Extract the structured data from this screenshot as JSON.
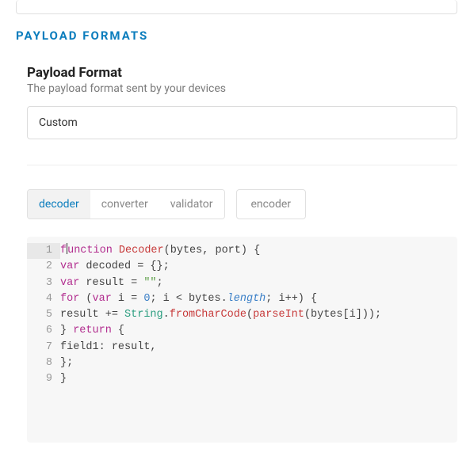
{
  "section_header": "PAYLOAD FORMATS",
  "subtitle": "Payload Format",
  "subdesc": "The payload format sent by your devices",
  "select_value": "Custom",
  "tabs": {
    "group": [
      {
        "label": "decoder",
        "active": true
      },
      {
        "label": "converter",
        "active": false
      },
      {
        "label": "validator",
        "active": false
      }
    ],
    "single": {
      "label": "encoder"
    }
  },
  "code": {
    "lines": [
      {
        "n": 1,
        "tokens": [
          {
            "t": "f",
            "c": "kw"
          },
          {
            "cursor": true
          },
          {
            "t": "unction ",
            "c": "kw"
          },
          {
            "t": "Decoder",
            "c": "fn"
          },
          {
            "t": "(",
            "c": "punc"
          },
          {
            "t": "bytes",
            "c": "id"
          },
          {
            "t": ", ",
            "c": "punc"
          },
          {
            "t": "port",
            "c": "id"
          },
          {
            "t": ") {",
            "c": "punc"
          }
        ]
      },
      {
        "n": 2,
        "tokens": [
          {
            "t": "var ",
            "c": "kw"
          },
          {
            "t": "decoded ",
            "c": "id"
          },
          {
            "t": "= ",
            "c": "punc"
          },
          {
            "t": "{};",
            "c": "punc"
          }
        ]
      },
      {
        "n": 3,
        "tokens": [
          {
            "t": "var ",
            "c": "kw"
          },
          {
            "t": "result ",
            "c": "id"
          },
          {
            "t": "= ",
            "c": "punc"
          },
          {
            "t": "\"\"",
            "c": "str"
          },
          {
            "t": ";",
            "c": "punc"
          }
        ]
      },
      {
        "n": 4,
        "tokens": [
          {
            "t": "for ",
            "c": "kw"
          },
          {
            "t": "(",
            "c": "punc"
          },
          {
            "t": "var ",
            "c": "kw"
          },
          {
            "t": "i ",
            "c": "id"
          },
          {
            "t": "= ",
            "c": "punc"
          },
          {
            "t": "0",
            "c": "num"
          },
          {
            "t": "; ",
            "c": "punc"
          },
          {
            "t": "i ",
            "c": "id"
          },
          {
            "t": "< ",
            "c": "punc"
          },
          {
            "t": "bytes",
            "c": "id"
          },
          {
            "t": ".",
            "c": "punc"
          },
          {
            "t": "length",
            "c": "prop"
          },
          {
            "t": "; ",
            "c": "punc"
          },
          {
            "t": "i",
            "c": "id"
          },
          {
            "t": "++) {",
            "c": "punc"
          }
        ]
      },
      {
        "n": 5,
        "tokens": [
          {
            "t": "result ",
            "c": "id"
          },
          {
            "t": "+= ",
            "c": "punc"
          },
          {
            "t": "String",
            "c": "obj"
          },
          {
            "t": ".",
            "c": "punc"
          },
          {
            "t": "fromCharCode",
            "c": "fn"
          },
          {
            "t": "(",
            "c": "punc"
          },
          {
            "t": "parseInt",
            "c": "fn"
          },
          {
            "t": "(",
            "c": "punc"
          },
          {
            "t": "bytes",
            "c": "id"
          },
          {
            "t": "[",
            "c": "punc"
          },
          {
            "t": "i",
            "c": "id"
          },
          {
            "t": "]));",
            "c": "punc"
          }
        ]
      },
      {
        "n": 6,
        "tokens": [
          {
            "t": "} ",
            "c": "punc"
          },
          {
            "t": "return ",
            "c": "kw"
          },
          {
            "t": "{",
            "c": "punc"
          }
        ]
      },
      {
        "n": 7,
        "tokens": [
          {
            "t": "field1",
            "c": "id"
          },
          {
            "t": ": ",
            "c": "punc"
          },
          {
            "t": "result",
            "c": "id"
          },
          {
            "t": ",",
            "c": "punc"
          }
        ]
      },
      {
        "n": 8,
        "tokens": [
          {
            "t": "};",
            "c": "punc"
          }
        ]
      },
      {
        "n": 9,
        "tokens": [
          {
            "t": "}",
            "c": "punc"
          }
        ]
      }
    ]
  }
}
